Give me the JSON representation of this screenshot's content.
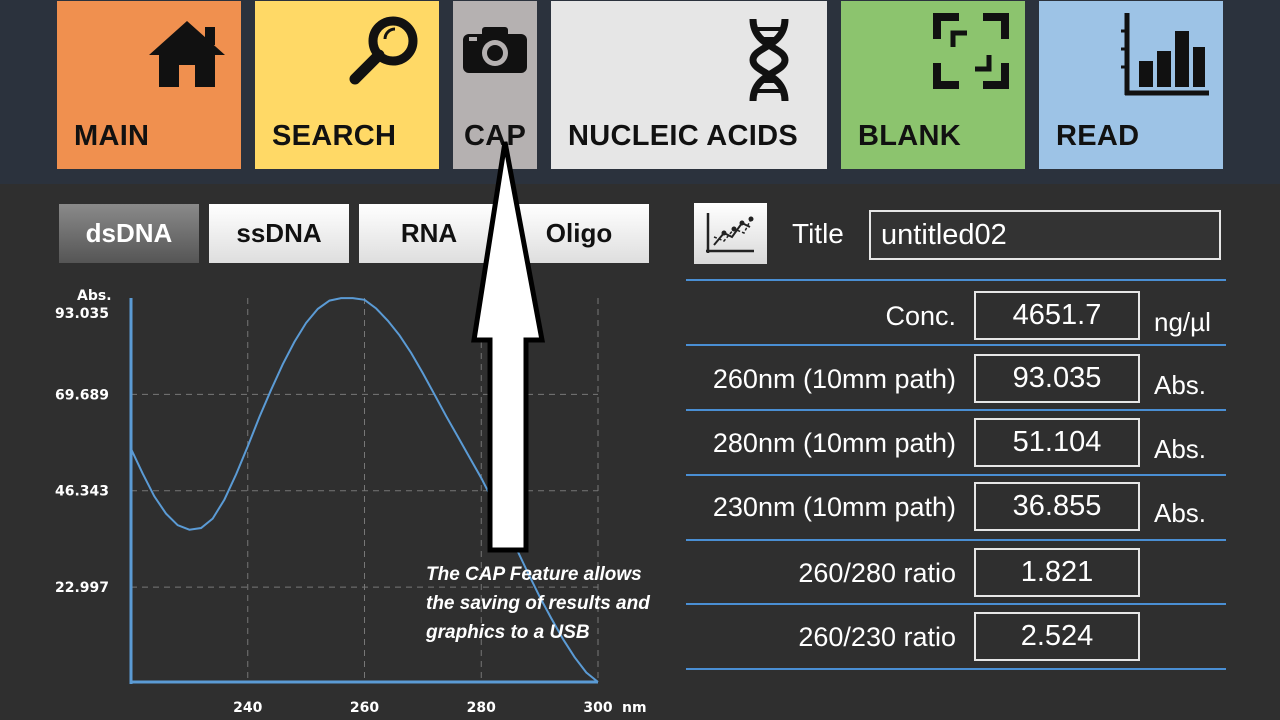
{
  "nav": [
    {
      "label": "MAIN",
      "icon": "home-icon",
      "color": "#f0904f"
    },
    {
      "label": "SEARCH",
      "icon": "search-icon",
      "color": "#ffd966"
    },
    {
      "label": "CAP",
      "icon": "camera-icon",
      "color": "#b5b1b1"
    },
    {
      "label": "NUCLEIC ACIDS",
      "icon": "dna-icon",
      "color": "#e6e6e6"
    },
    {
      "label": "BLANK",
      "icon": "blank-frame-icon",
      "color": "#8cc46e"
    },
    {
      "label": "READ",
      "icon": "bar-chart-icon",
      "color": "#9dc3e6"
    }
  ],
  "tabs": [
    {
      "label": "dsDNA",
      "active": true
    },
    {
      "label": "ssDNA",
      "active": false
    },
    {
      "label": "RNA",
      "active": false
    },
    {
      "label": "Oligo",
      "active": false
    }
  ],
  "graph_button_icon": "line-graph-icon",
  "title": {
    "label": "Title",
    "value": "untitled02"
  },
  "results": [
    {
      "label": "Conc.",
      "value": "4651.7",
      "unit": "ng/µl"
    },
    {
      "label": "260nm (10mm path)",
      "value": "93.035",
      "unit": "Abs."
    },
    {
      "label": "280nm (10mm path)",
      "value": "51.104",
      "unit": "Abs."
    },
    {
      "label": "230nm (10mm path)",
      "value": "36.855",
      "unit": "Abs."
    },
    {
      "label": "260/280 ratio",
      "value": "1.821",
      "unit": ""
    },
    {
      "label": "260/230 ratio",
      "value": "2.524",
      "unit": ""
    }
  ],
  "annotation": "The CAP Feature allows the saving of results and graphics to a USB",
  "chart_data": {
    "type": "line",
    "ylabel": "Abs.",
    "xunit": "nm",
    "x_ticks": [
      "240",
      "260",
      "280",
      "300"
    ],
    "y_ticks": [
      "93.035",
      "69.689",
      "46.343",
      "22.997"
    ],
    "xlim": [
      220,
      300
    ],
    "ylim": [
      0,
      93.035
    ],
    "grid": true,
    "series": [
      {
        "color": "#5b9bd5",
        "x": [
          220,
          222,
          224,
          226,
          228,
          230,
          232,
          234,
          236,
          238,
          240,
          242,
          244,
          246,
          248,
          250,
          252,
          254,
          256,
          258,
          260,
          262,
          264,
          266,
          268,
          270,
          272,
          274,
          276,
          278,
          280,
          282,
          284,
          286,
          288,
          290,
          292,
          294,
          296,
          298,
          300
        ],
        "y": [
          56.5,
          50.5,
          45.0,
          40.8,
          38.0,
          36.9,
          37.3,
          39.6,
          44.2,
          50.3,
          57.1,
          64.2,
          70.8,
          77.0,
          82.4,
          87.0,
          90.4,
          92.4,
          93.0,
          93.0,
          92.6,
          90.5,
          87.5,
          84.0,
          79.7,
          74.8,
          69.6,
          64.4,
          59.4,
          54.4,
          49.4,
          43.9,
          38.3,
          32.4,
          26.4,
          20.7,
          15.4,
          10.4,
          6.0,
          2.3,
          0
        ]
      }
    ]
  }
}
